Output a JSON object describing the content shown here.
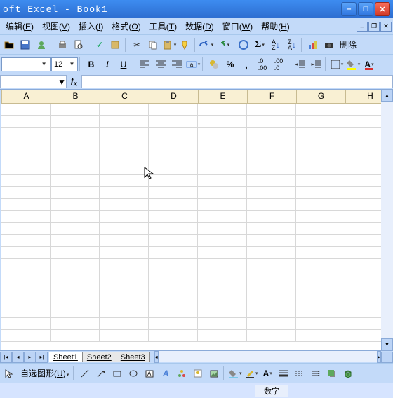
{
  "title": "oft Excel - Book1",
  "menu": [
    {
      "label": "编辑",
      "accel": "E"
    },
    {
      "label": "视图",
      "accel": "V"
    },
    {
      "label": "插入",
      "accel": "I"
    },
    {
      "label": "格式",
      "accel": "O"
    },
    {
      "label": "工具",
      "accel": "T"
    },
    {
      "label": "数据",
      "accel": "D"
    },
    {
      "label": "窗口",
      "accel": "W"
    },
    {
      "label": "帮助",
      "accel": "H"
    }
  ],
  "font": {
    "name": "",
    "size": "12"
  },
  "delete_label": "删除",
  "namebox": "",
  "columns": [
    "A",
    "B",
    "C",
    "D",
    "E",
    "F",
    "G",
    "H"
  ],
  "rows": 20,
  "sheets": [
    "Sheet1",
    "Sheet2",
    "Sheet3"
  ],
  "active_sheet": 0,
  "autoshapes_label": "自选图形",
  "autoshapes_accel": "U",
  "status_text": "数字",
  "colors": {
    "accent": "#3d8cf0",
    "header_fill": "#f9f0d3"
  }
}
